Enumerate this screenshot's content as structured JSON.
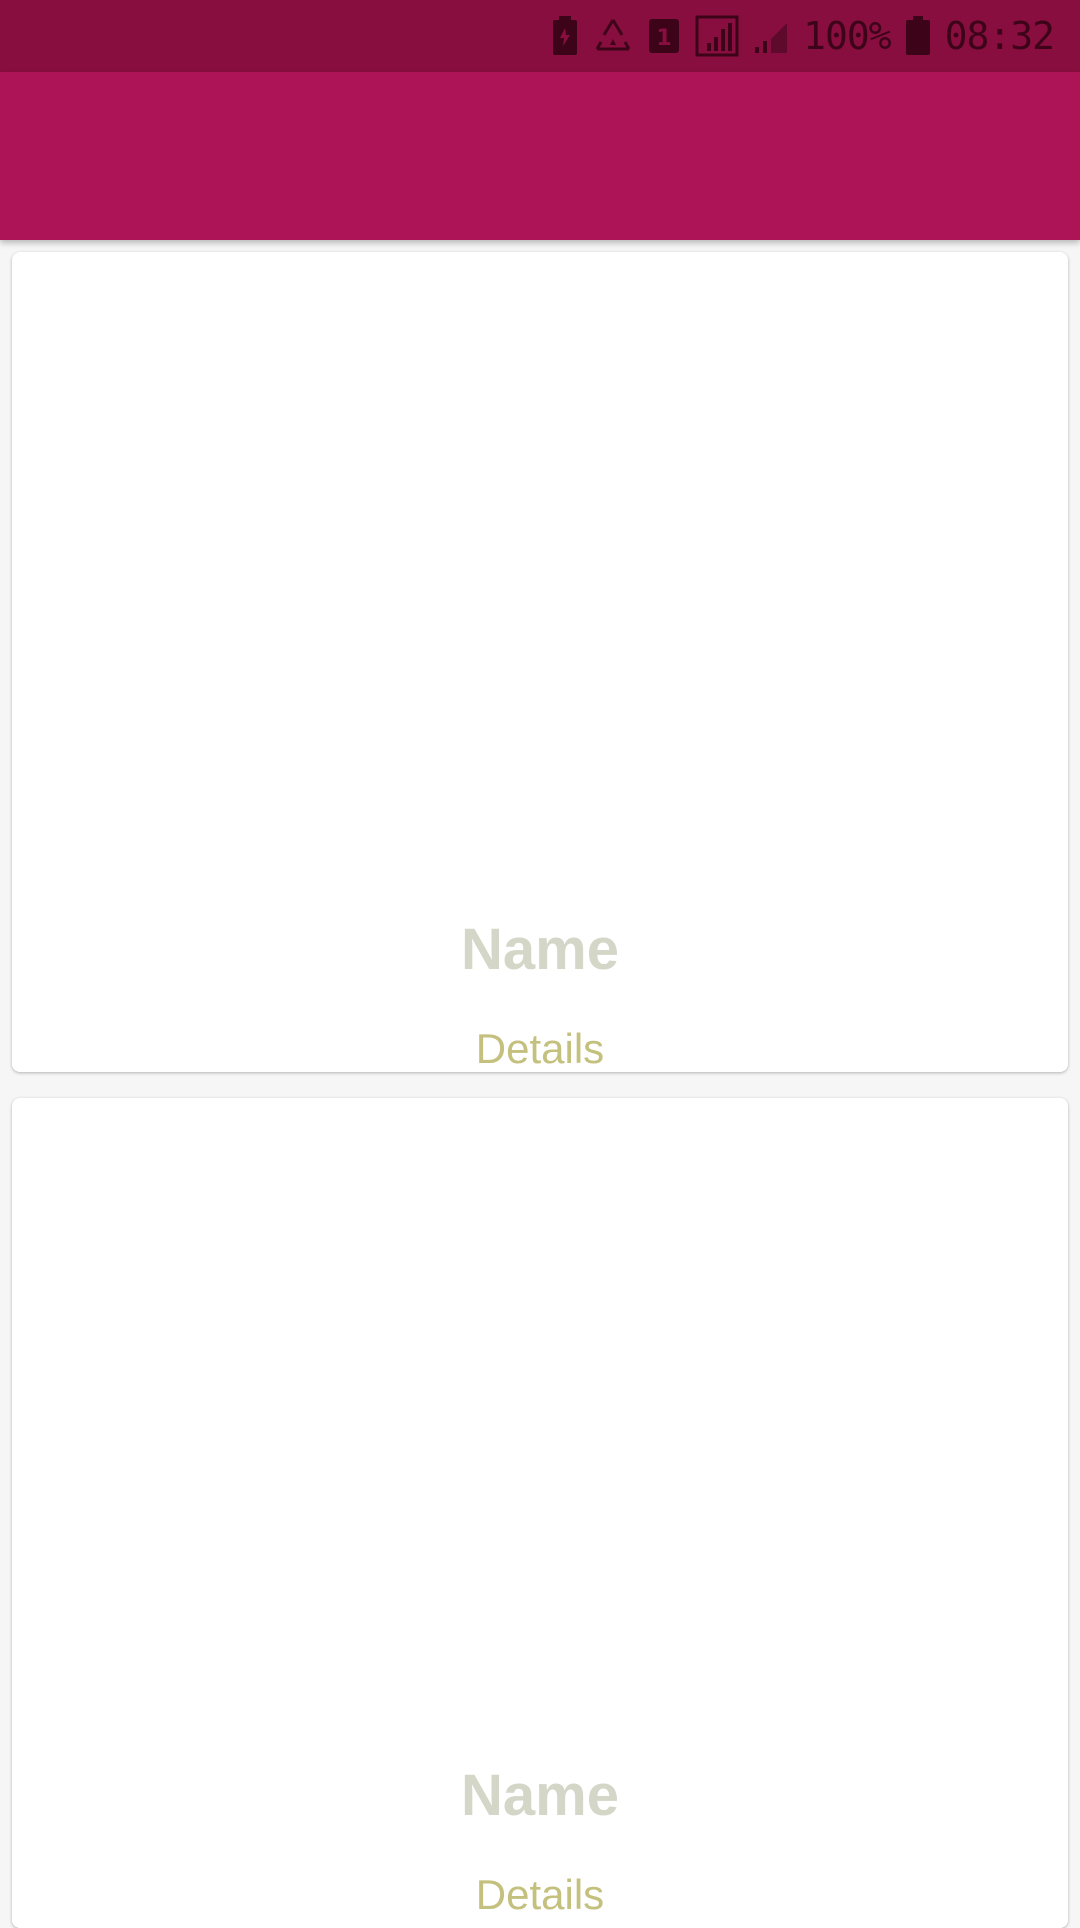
{
  "status_bar": {
    "icons": [
      "battery-saver-icon",
      "recycle-icon",
      "sim-1-icon",
      "signal-icon",
      "signal-weak-icon",
      "battery-icon"
    ],
    "battery_percent": "100%",
    "time": "08:32"
  },
  "app_bar": {
    "color": "#ad1457"
  },
  "cards": [
    {
      "name": "Name",
      "details": "Details"
    },
    {
      "name": "Name",
      "details": "Details"
    }
  ],
  "colors": {
    "status_bar": "#880e3f",
    "app_bar": "#ad1457",
    "name_text": "#d4d6c8",
    "details_text": "#c4c07e",
    "background": "#f6f6f6"
  }
}
